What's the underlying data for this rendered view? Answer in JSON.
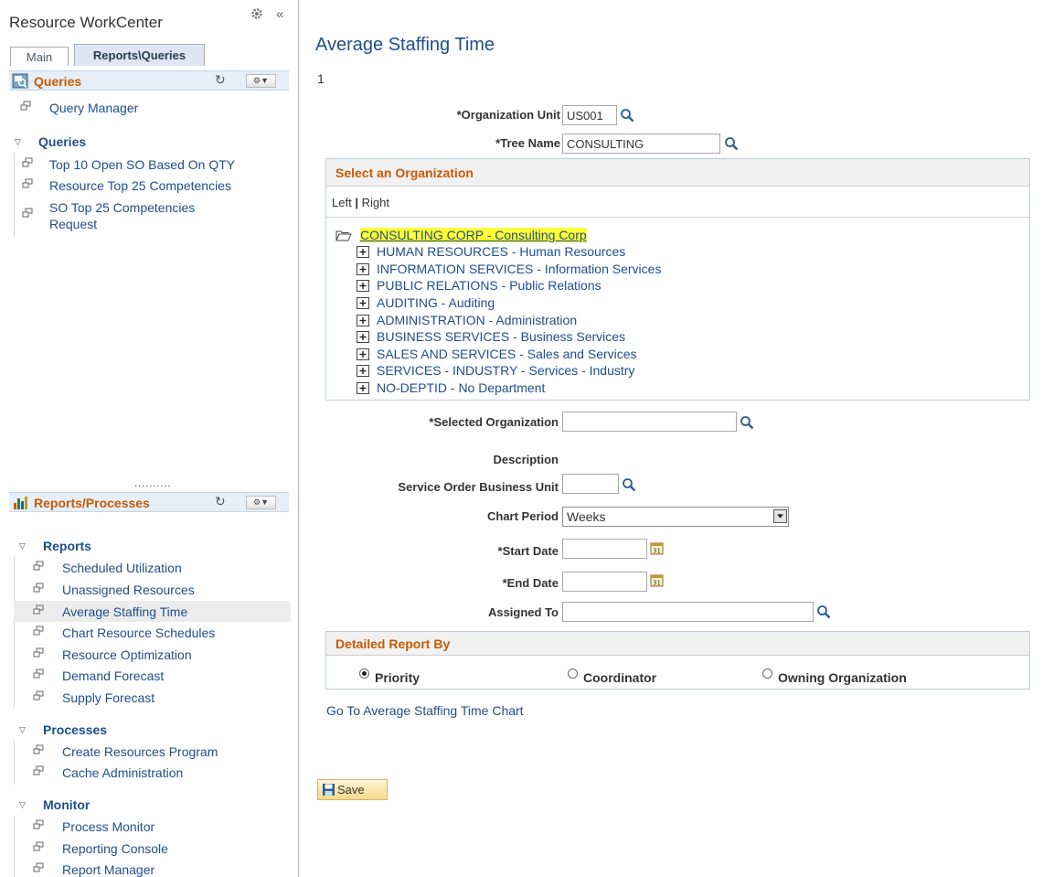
{
  "sidebar": {
    "title": "Resource WorkCenter",
    "collapse_glyph": "«",
    "tabs": [
      {
        "label": "Main",
        "active": false
      },
      {
        "label": "Reports\\Queries",
        "active": true
      }
    ],
    "queries_section": {
      "title": "Queries",
      "icon": "queries-icon",
      "top_items": [
        {
          "label": "Query Manager"
        }
      ],
      "group": {
        "label": "Queries",
        "items": [
          {
            "label": "Top 10 Open SO Based On QTY"
          },
          {
            "label": "Resource Top 25 Competencies"
          },
          {
            "label": "SO Top 25 Competencies"
          },
          {
            "label": "Request"
          }
        ]
      }
    },
    "grip": "..........",
    "reports_section": {
      "title": "Reports/Processes",
      "icon": "bar-chart-icon",
      "groups": [
        {
          "label": "Reports",
          "items": [
            {
              "label": "Scheduled Utilization"
            },
            {
              "label": "Unassigned Resources"
            },
            {
              "label": "Average Staffing Time",
              "active": true
            },
            {
              "label": "Chart Resource Schedules"
            },
            {
              "label": "Resource Optimization"
            },
            {
              "label": "Demand Forecast"
            },
            {
              "label": "Supply Forecast"
            }
          ]
        },
        {
          "label": "Processes",
          "items": [
            {
              "label": "Create Resources Program"
            },
            {
              "label": "Cache Administration"
            }
          ]
        },
        {
          "label": "Monitor",
          "items": [
            {
              "label": "Process Monitor"
            },
            {
              "label": "Reporting Console"
            },
            {
              "label": "Report Manager"
            }
          ]
        }
      ]
    }
  },
  "main": {
    "title": "Average Staffing Time",
    "page_number": "1",
    "fields": {
      "org_unit": {
        "label": "*Organization Unit",
        "value": "US001"
      },
      "tree_name": {
        "label": "*Tree Name",
        "value": "CONSULTING"
      },
      "selected_org": {
        "label": "*Selected Organization",
        "value": ""
      },
      "description": {
        "label": "Description"
      },
      "so_business_unit": {
        "label": "Service Order Business Unit",
        "value": ""
      },
      "chart_period": {
        "label": "Chart Period",
        "value": "Weeks"
      },
      "start_date": {
        "label": "*Start Date",
        "value": ""
      },
      "end_date": {
        "label": "*End Date",
        "value": ""
      },
      "assigned_to": {
        "label": "Assigned To",
        "value": ""
      }
    },
    "org_panel": {
      "title": "Select an Organization",
      "nav_left": "Left",
      "nav_sep": "|",
      "nav_right": "Right",
      "root": "CONSULTING CORP - Consulting Corp",
      "nodes": [
        "HUMAN RESOURCES - Human Resources",
        "INFORMATION SERVICES - Information Services",
        "PUBLIC RELATIONS - Public Relations",
        "AUDITING - Auditing",
        "ADMINISTRATION - Administration",
        "BUSINESS SERVICES - Business Services",
        "SALES AND SERVICES - Sales and Services",
        "SERVICES - INDUSTRY - Services - Industry",
        "NO-DEPTID - No Department"
      ]
    },
    "detail_panel": {
      "title": "Detailed Report By",
      "options": [
        {
          "label": "Priority",
          "checked": true
        },
        {
          "label": "Coordinator",
          "checked": false
        },
        {
          "label": "Owning Organization",
          "checked": false
        }
      ]
    },
    "chart_link": "Go To Average Staffing Time Chart",
    "save_label": "Save"
  }
}
